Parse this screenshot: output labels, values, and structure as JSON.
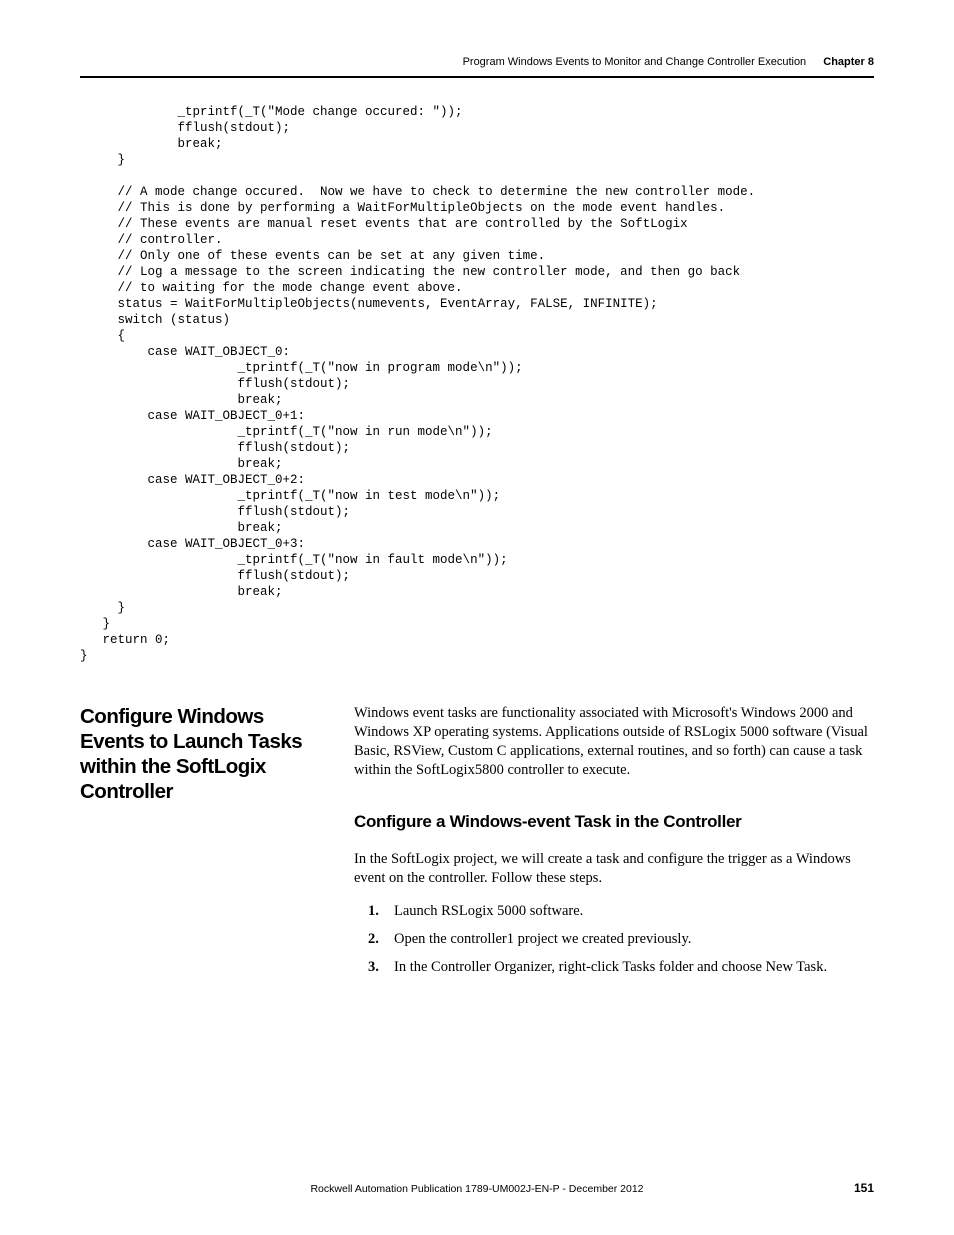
{
  "running_head": {
    "title": "Program Windows Events to Monitor and Change Controller Execution",
    "chapter": "Chapter 8"
  },
  "code": "             _tprintf(_T(\"Mode change occured: \"));\n             fflush(stdout);\n             break;\n     }\n\n     // A mode change occured.  Now we have to check to determine the new controller mode.\n     // This is done by performing a WaitForMultipleObjects on the mode event handles.\n     // These events are manual reset events that are controlled by the SoftLogix\n     // controller.\n     // Only one of these events can be set at any given time.\n     // Log a message to the screen indicating the new controller mode, and then go back\n     // to waiting for the mode change event above.\n     status = WaitForMultipleObjects(numevents, EventArray, FALSE, INFINITE);\n     switch (status)\n     {\n         case WAIT_OBJECT_0:\n                     _tprintf(_T(\"now in program mode\\n\"));\n                     fflush(stdout);\n                     break;\n         case WAIT_OBJECT_0+1:\n                     _tprintf(_T(\"now in run mode\\n\"));\n                     fflush(stdout);\n                     break;\n         case WAIT_OBJECT_0+2:\n                     _tprintf(_T(\"now in test mode\\n\"));\n                     fflush(stdout);\n                     break;\n         case WAIT_OBJECT_0+3:\n                     _tprintf(_T(\"now in fault mode\\n\"));\n                     fflush(stdout);\n                     break;\n     }\n   }\n   return 0;\n}",
  "section": {
    "title": "Configure Windows Events to Launch Tasks within the SoftLogix Controller",
    "intro": "Windows event tasks are functionality associated with Microsoft's Windows 2000 and Windows XP operating systems. Applications outside of RSLogix 5000 software (Visual Basic, RSView, Custom C applications, external routines, and so forth) can cause a task within the SoftLogix5800 controller to execute.",
    "subheading": "Configure a Windows-event Task in the Controller",
    "lead": "In the SoftLogix project, we will create a task and configure the trigger as a Windows event on the controller. Follow these steps.",
    "steps": [
      "Launch RSLogix 5000 software.",
      "Open the controller1 project we created previously.",
      "In the Controller Organizer, right-click Tasks folder and choose New Task."
    ]
  },
  "footer": {
    "center": "Rockwell Automation Publication 1789-UM002J-EN-P - December 2012",
    "page": "151"
  }
}
